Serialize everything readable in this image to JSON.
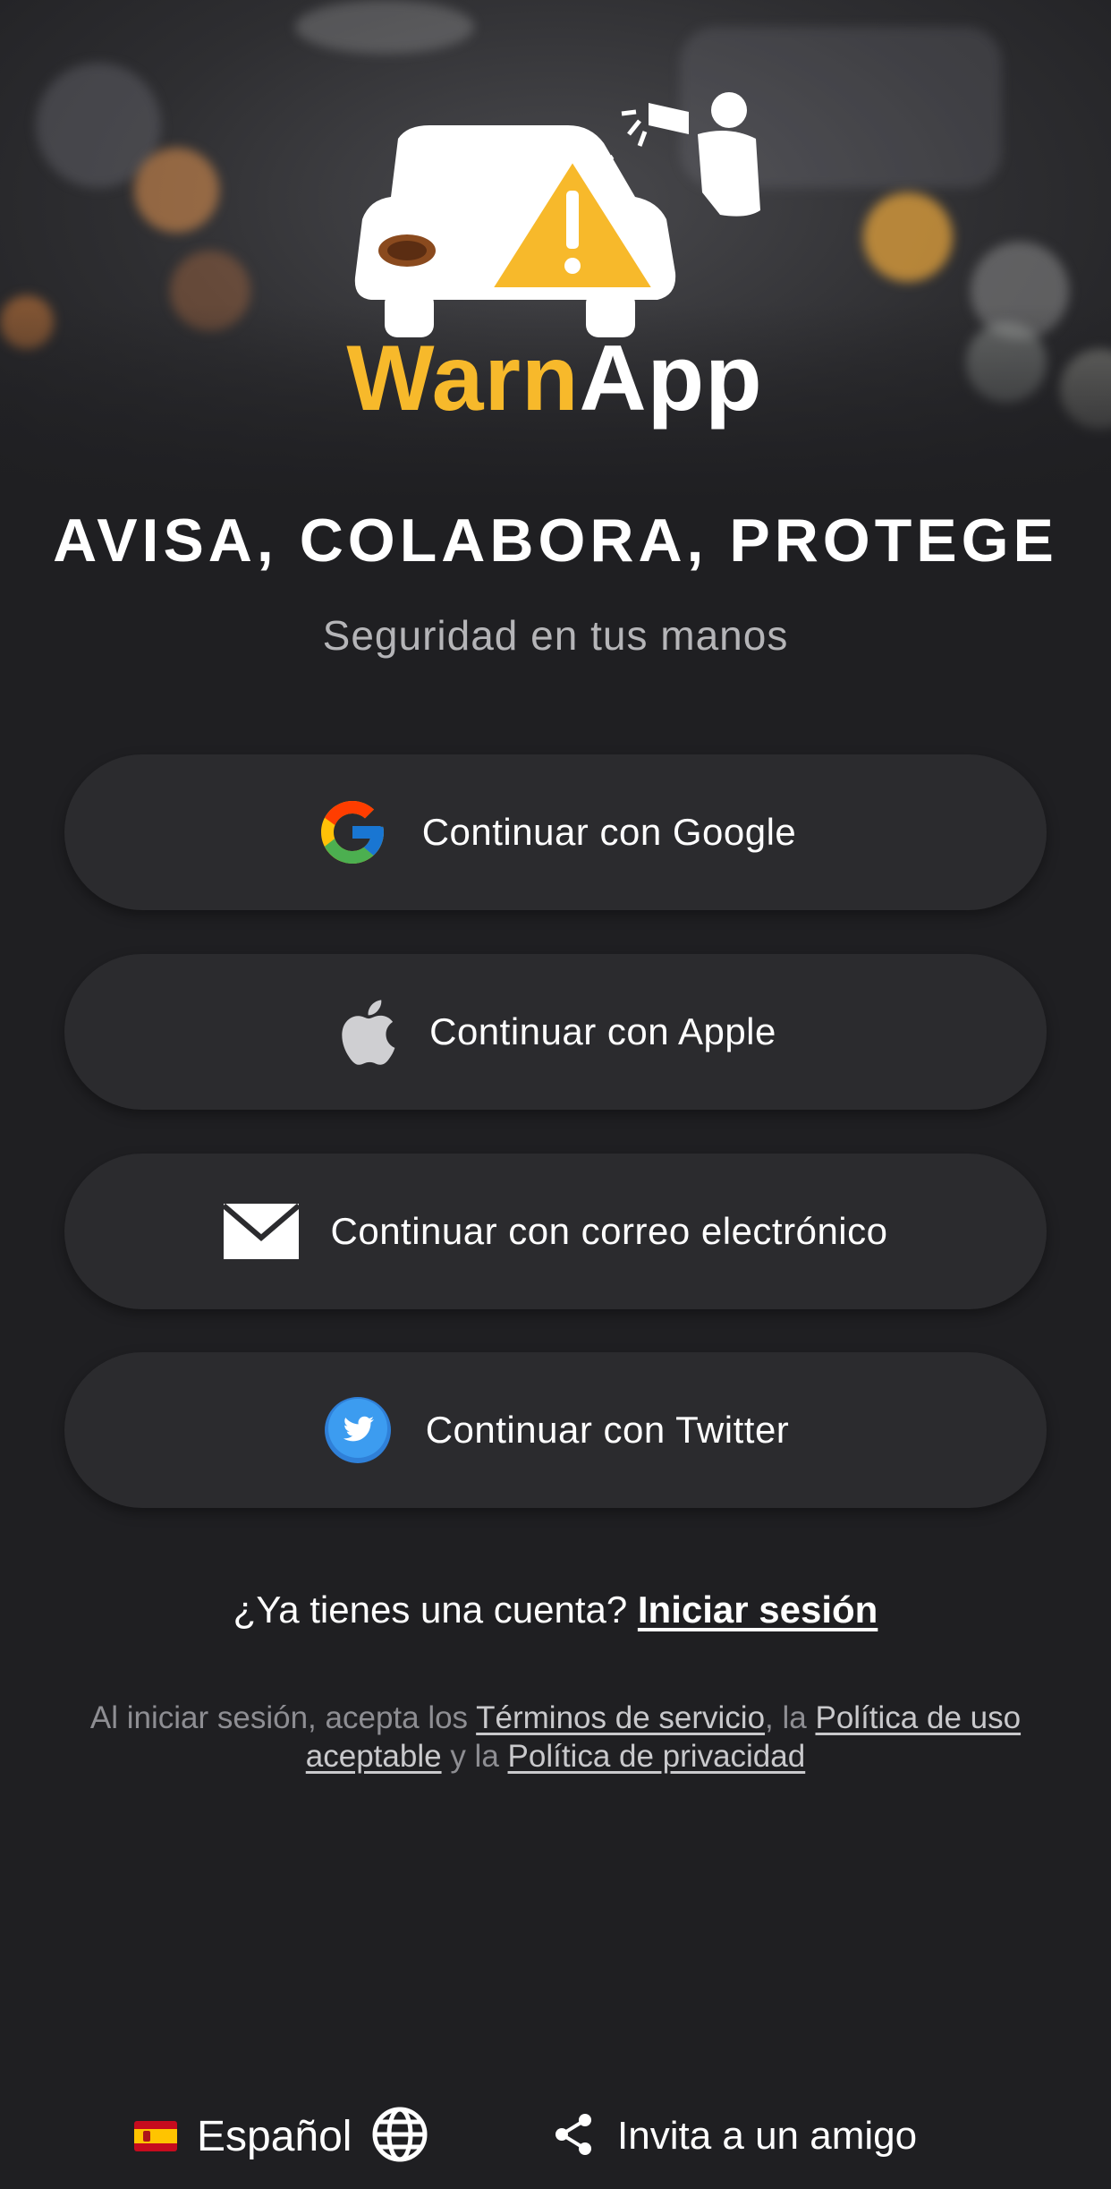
{
  "brand": {
    "name_part1": "Warn",
    "name_part2": "App",
    "tagline": "AVISA, COLABORA, PROTEGE",
    "subtitle": "Seguridad en tus manos",
    "colors": {
      "accent": "#f7b92b",
      "background": "#1f1f22",
      "button": "#2b2b2e"
    }
  },
  "auth_buttons": [
    {
      "label": "Continuar con Google",
      "icon": "google-icon"
    },
    {
      "label": "Continuar con Apple",
      "icon": "apple-icon"
    },
    {
      "label": "Continuar con correo electrónico",
      "icon": "envelope-icon"
    },
    {
      "label": "Continuar con Twitter",
      "icon": "twitter-icon"
    }
  ],
  "signin": {
    "prompt": "¿Ya tienes una cuenta?",
    "link": "Iniciar sesión"
  },
  "legal": {
    "prefix": "Al iniciar sesión, acepta los",
    "terms": "Términos de servicio",
    "sep1": ", la",
    "acceptable_use": "Política de uso aceptable",
    "sep2": "y la",
    "privacy": "Política de privacidad"
  },
  "footer": {
    "language": "Español",
    "language_flag": "spain-flag-icon",
    "language_icon": "globe-icon",
    "invite": "Invita a un amigo",
    "invite_icon": "share-icon"
  }
}
